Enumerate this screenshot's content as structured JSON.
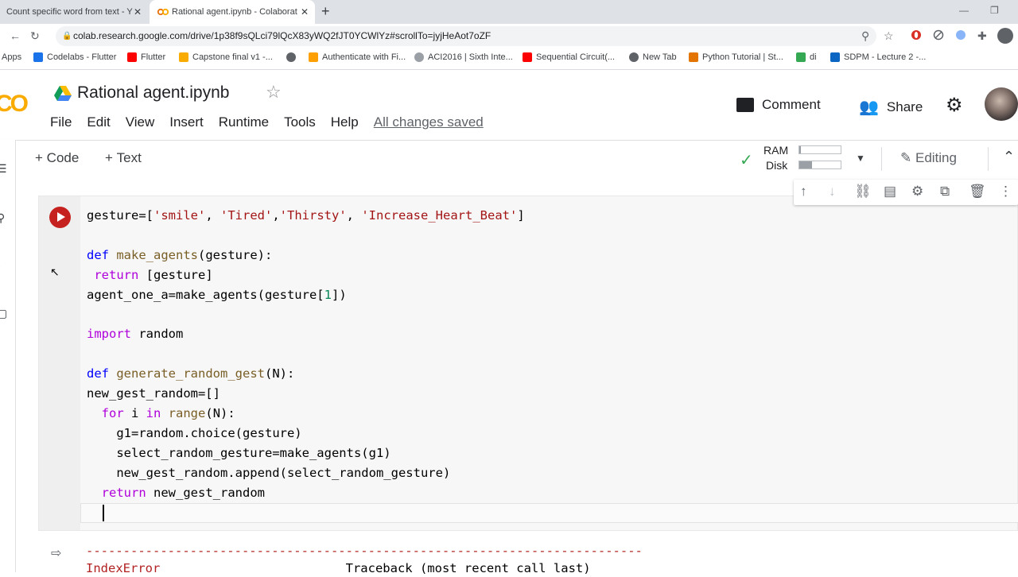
{
  "browser": {
    "tabs": [
      {
        "title": "Count specific word from text - Y"
      },
      {
        "title": "Rational agent.ipynb - Colaborat"
      }
    ],
    "url": "colab.research.google.com/drive/1p38f9sQLci79lQcX83yWQ2fJT0YCWlYz#scrollTo=jyjHeAot7oZF",
    "bookmarks": [
      {
        "label": "Apps",
        "color": ""
      },
      {
        "label": "Codelabs - Flutter",
        "color": "#1a73e8"
      },
      {
        "label": "Flutter",
        "color": "#ff0000"
      },
      {
        "label": "Capstone final v1 -...",
        "color": "#f9ab00"
      },
      {
        "label": "",
        "color": "#5f6368"
      },
      {
        "label": "Authenticate with Fi...",
        "color": "#ffa000"
      },
      {
        "label": "ACI2016 | Sixth Inte...",
        "color": "#9aa0a6"
      },
      {
        "label": "Sequential Circuit(...",
        "color": "#ff0000"
      },
      {
        "label": "New Tab",
        "color": "#5f6368"
      },
      {
        "label": "Python Tutorial | St...",
        "color": "#e37400"
      },
      {
        "label": "di",
        "color": "#34a853"
      },
      {
        "label": "SDPM - Lecture 2 -...",
        "color": "#0a66c2"
      }
    ]
  },
  "colab": {
    "logo": "CO",
    "title": "Rational agent.ipynb",
    "menu": [
      "File",
      "Edit",
      "View",
      "Insert",
      "Runtime",
      "Tools",
      "Help"
    ],
    "saved_status": "All changes saved",
    "comment_label": "Comment",
    "share_label": "Share",
    "add_code": "Code",
    "add_text": "Text",
    "ram_label": "RAM",
    "disk_label": "Disk",
    "ram_usage": 0.03,
    "disk_usage": 0.3,
    "editing_label": "Editing"
  },
  "cell": {
    "code_lines": [
      "gesture=['smile', 'Tired','Thirsty', 'Increase_Heart_Beat']",
      "",
      "def make_agents(gesture):",
      " return [gesture]",
      "agent_one_a=make_agents(gesture[1])",
      "",
      "import random",
      "",
      "def generate_random_gest(N):",
      "new_gest_random=[]",
      "  for i in range(N):",
      "    g1=random.choice(gesture)",
      "    select_random_gesture=make_agents(g1)",
      "    new_gest_random.append(select_random_gesture)",
      "  return new_gest_random",
      ""
    ],
    "output": {
      "separator": "---------------------------------------------------------------------------",
      "error_name": "IndexError",
      "traceback": "Traceback (most recent call last)"
    }
  }
}
